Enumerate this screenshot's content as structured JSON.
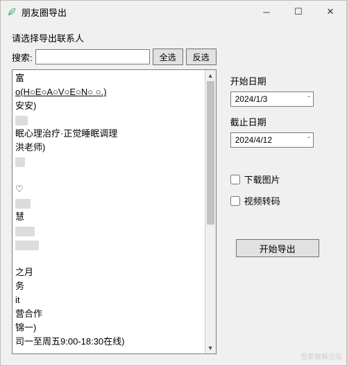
{
  "window": {
    "title": "朋友圈导出",
    "feather_icon": "feather-icon"
  },
  "left": {
    "group_label": "请选择导出联系人",
    "search_label": "搜索:",
    "search_value": "",
    "select_all": "全选",
    "invert": "反选",
    "items": [
      {
        "blur_w": 0,
        "suffix": "富"
      },
      {
        "blur_w": 0,
        "suffix": "o(H○E○A○V○E○N○ ○.)",
        "underline": true
      },
      {
        "blur_w": 0,
        "suffix": "安安)"
      },
      {
        "blur_w": 18,
        "suffix": ""
      },
      {
        "blur_w": 0,
        "suffix": "眠心理治疗·正觉睡眠调理"
      },
      {
        "blur_w": 0,
        "suffix": "洪老师)"
      },
      {
        "blur_w": 14,
        "suffix": ""
      },
      {
        "blur_w": 0,
        "suffix": ""
      },
      {
        "blur_w": 0,
        "suffix": "♡"
      },
      {
        "blur_w": 22,
        "suffix": ""
      },
      {
        "blur_w": 0,
        "suffix": "慧"
      },
      {
        "blur_w": 28,
        "suffix": ""
      },
      {
        "blur_w": 34,
        "suffix": ""
      },
      {
        "blur_w": 0,
        "suffix": ""
      },
      {
        "blur_w": 0,
        "suffix": "之月"
      },
      {
        "blur_w": 0,
        "suffix": "务"
      },
      {
        "blur_w": 0,
        "suffix": " it"
      },
      {
        "blur_w": 0,
        "suffix": "营合作"
      },
      {
        "blur_w": 0,
        "suffix": "锦一)"
      },
      {
        "blur_w": 0,
        "suffix": "司一至周五9:00-18:30在线)"
      }
    ]
  },
  "right": {
    "start_label": "开始日期",
    "start_value": "2024/1/3",
    "end_label": "截止日期",
    "end_value": "2024/4/12",
    "download_img": "下载图片",
    "video_trans": "视频转码",
    "export_btn": "开始导出"
  },
  "watermark": "吾爱破解论坛"
}
